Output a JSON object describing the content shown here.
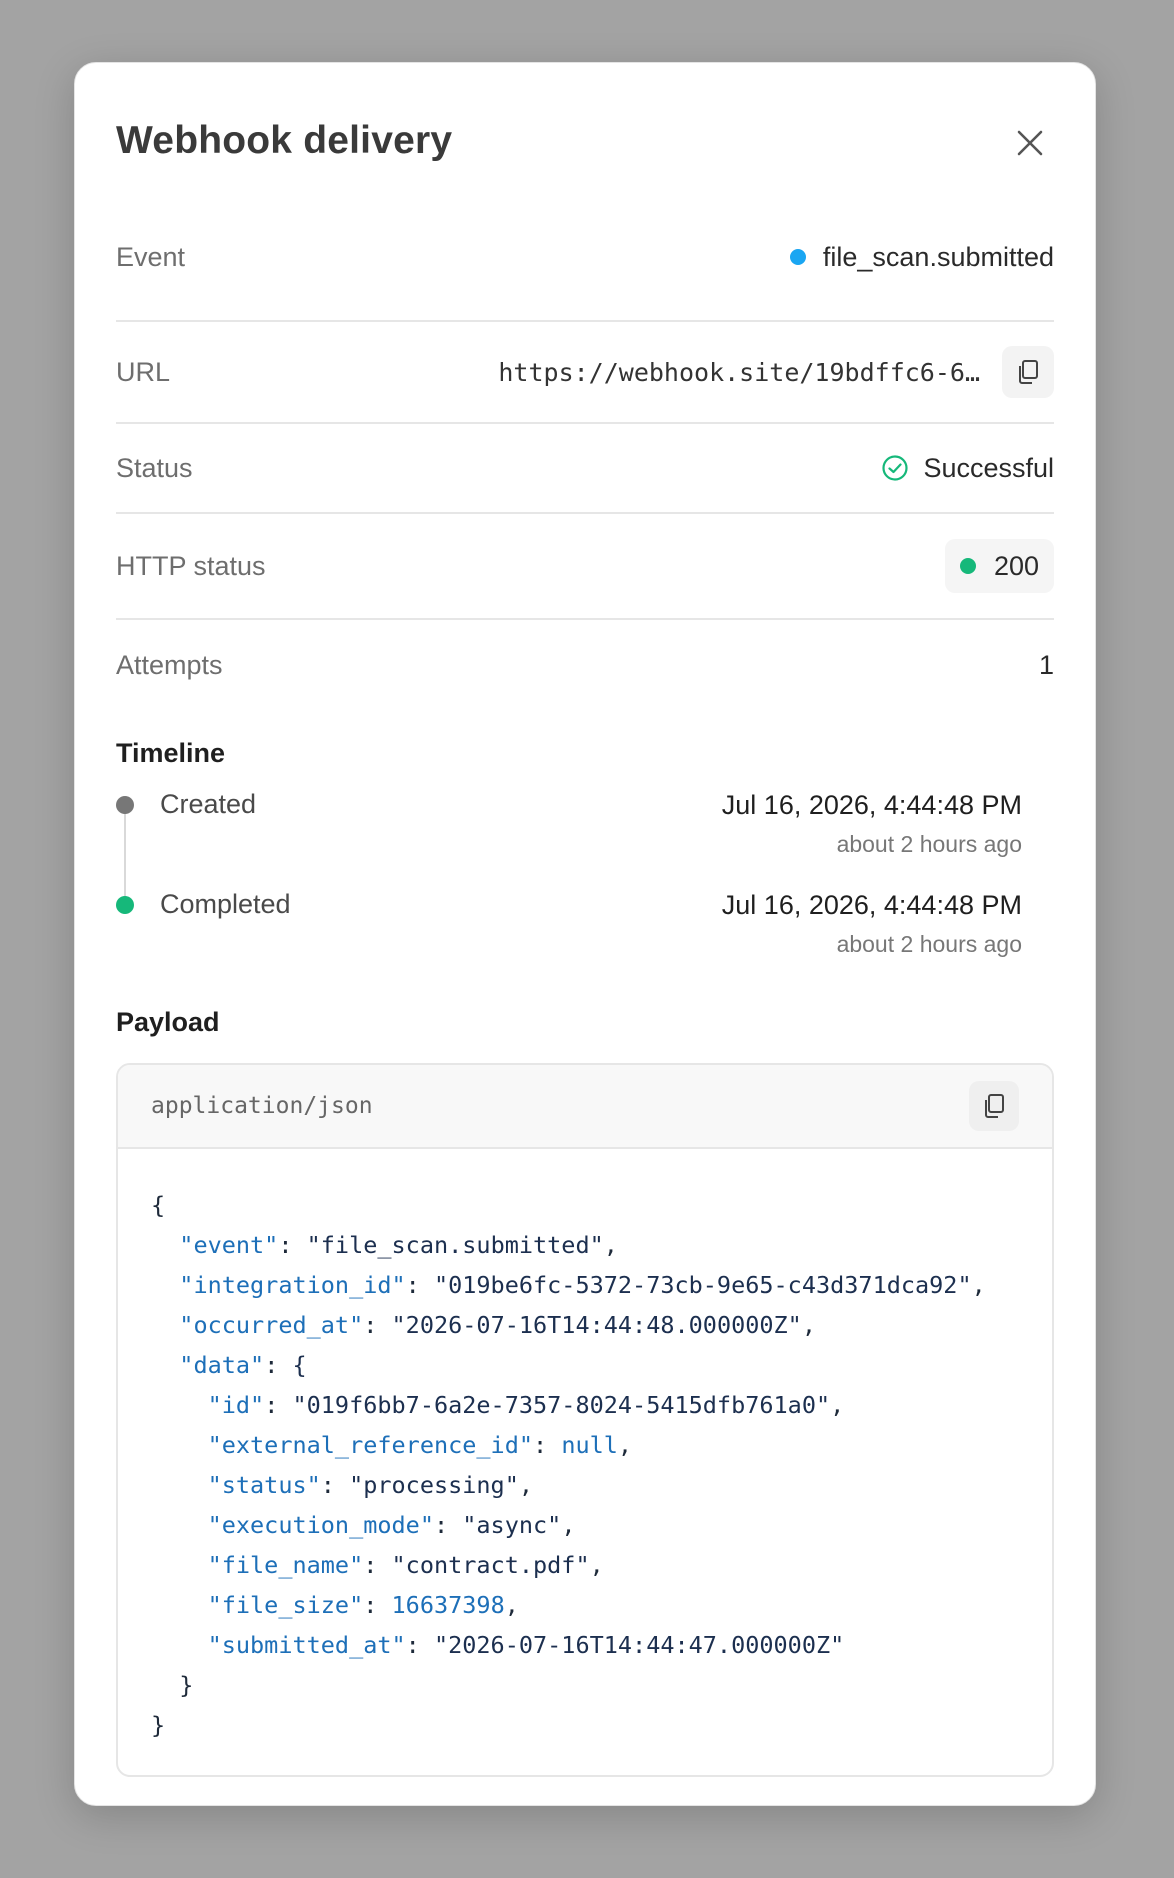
{
  "modal": {
    "title": "Webhook delivery"
  },
  "details": {
    "event_label": "Event",
    "event_value": "file_scan.submitted",
    "url_label": "URL",
    "url_value": "https://webhook.site/19bdffc6-6…",
    "status_label": "Status",
    "status_value": "Successful",
    "http_label": "HTTP status",
    "http_value": "200",
    "attempts_label": "Attempts",
    "attempts_value": "1"
  },
  "timeline": {
    "title": "Timeline",
    "items": [
      {
        "label": "Created",
        "date": "Jul 16, 2026, 4:44:48 PM",
        "relative": "about 2 hours ago"
      },
      {
        "label": "Completed",
        "date": "Jul 16, 2026, 4:44:48 PM",
        "relative": "about 2 hours ago"
      }
    ]
  },
  "payload": {
    "title": "Payload",
    "content_type": "application/json",
    "lines": [
      {
        "indent": 0,
        "key": "",
        "value": "",
        "text": "{"
      },
      {
        "indent": 1,
        "key": "\"event\"",
        "value": "\"file_scan.submitted\"",
        "vtype": "s",
        "suffix": ","
      },
      {
        "indent": 1,
        "key": "\"integration_id\"",
        "value": "\"019be6fc-5372-73cb-9e65-c43d371dca92\"",
        "vtype": "s",
        "suffix": ","
      },
      {
        "indent": 1,
        "key": "\"occurred_at\"",
        "value": "\"2026-07-16T14:44:48.000000Z\"",
        "vtype": "s",
        "suffix": ","
      },
      {
        "indent": 1,
        "key": "\"data\"",
        "value": "{",
        "vtype": "p",
        "suffix": ""
      },
      {
        "indent": 2,
        "key": "\"id\"",
        "value": "\"019f6bb7-6a2e-7357-8024-5415dfb761a0\"",
        "vtype": "s",
        "suffix": ","
      },
      {
        "indent": 2,
        "key": "\"external_reference_id\"",
        "value": "null",
        "vtype": "n",
        "suffix": ","
      },
      {
        "indent": 2,
        "key": "\"status\"",
        "value": "\"processing\"",
        "vtype": "s",
        "suffix": ","
      },
      {
        "indent": 2,
        "key": "\"execution_mode\"",
        "value": "\"async\"",
        "vtype": "s",
        "suffix": ","
      },
      {
        "indent": 2,
        "key": "\"file_name\"",
        "value": "\"contract.pdf\"",
        "vtype": "s",
        "suffix": ","
      },
      {
        "indent": 2,
        "key": "\"file_size\"",
        "value": "16637398",
        "vtype": "n",
        "suffix": ","
      },
      {
        "indent": 2,
        "key": "\"submitted_at\"",
        "value": "\"2026-07-16T14:44:47.000000Z\"",
        "vtype": "s",
        "suffix": ""
      },
      {
        "indent": 1,
        "key": "",
        "value": "",
        "text": "}"
      },
      {
        "indent": 0,
        "key": "",
        "value": "",
        "text": "}"
      }
    ]
  },
  "colors": {
    "event_dot": "#1aa6f2",
    "success_green": "#16b87a",
    "created_dot": "#777777"
  },
  "icons": {
    "close": "close-icon",
    "copy": "copy-icon",
    "status": "check-circle-icon"
  }
}
